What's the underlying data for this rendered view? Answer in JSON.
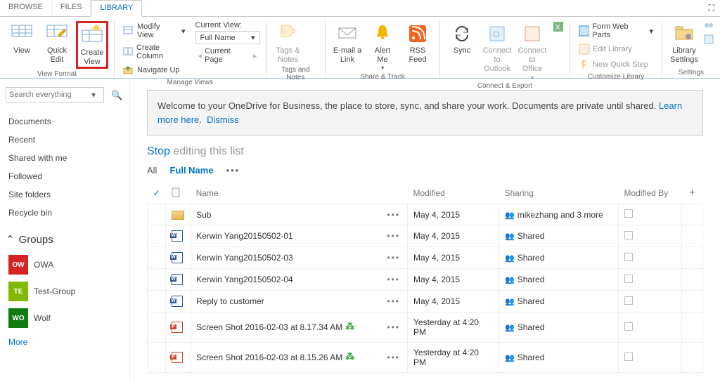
{
  "tabs": {
    "browse": "BROWSE",
    "files": "FILES",
    "library": "LIBRARY"
  },
  "ribbon": {
    "view_format": {
      "view": "View",
      "quick_edit": "Quick\nEdit",
      "create_view": "Create\nView",
      "label": "View Format"
    },
    "manage_views": {
      "modify_view": "Modify View",
      "create_column": "Create Column",
      "navigate_up": "Navigate Up",
      "current_view": "Current View:",
      "full_name": "Full Name",
      "current_page": "Current Page",
      "label": "Manage Views"
    },
    "tags_notes": {
      "tags": "Tags &\nNotes",
      "label": "Tags and Notes"
    },
    "share_track": {
      "email": "E-mail a\nLink",
      "alert": "Alert\nMe",
      "rss": "RSS\nFeed",
      "label": "Share & Track"
    },
    "connect_export": {
      "sync": "Sync",
      "outlook": "Connect to\nOutlook",
      "office": "Connect to\nOffice",
      "label": "Connect & Export"
    },
    "customize": {
      "form": "Form Web Parts",
      "edit": "Edit Library",
      "quick": "New Quick Step",
      "label": "Customize Library"
    },
    "settings": {
      "lib": "Library\nSettings",
      "label": "Settings"
    }
  },
  "sidebar": {
    "search_placeholder": "Search everything",
    "nav": [
      "Documents",
      "Recent",
      "Shared with me",
      "Followed",
      "Site folders",
      "Recycle bin"
    ],
    "groups_label": "Groups",
    "groups": [
      {
        "code": "OW",
        "color": "#d62424",
        "name": "OWA"
      },
      {
        "code": "TE",
        "color": "#7fba00",
        "name": "Test-Group"
      },
      {
        "code": "WO",
        "color": "#107c10",
        "name": "Wolf"
      }
    ],
    "more": "More"
  },
  "banner": {
    "text": "Welcome to your OneDrive for Business, the place to store, sync, and share your work. Documents are private until shared. ",
    "learn": "Learn more here",
    "dismiss": "Dismiss"
  },
  "list_header": {
    "stop": "Stop",
    "rest": " editing this list"
  },
  "views": {
    "all": "All",
    "full": "Full Name"
  },
  "columns": {
    "name": "Name",
    "modified": "Modified",
    "sharing": "Sharing",
    "modified_by": "Modified By"
  },
  "rows": [
    {
      "type": "folder",
      "name": "Sub",
      "new": false,
      "modified": "May 4, 2015",
      "sharing": "mikezhang and 3 more"
    },
    {
      "type": "doc",
      "name": "Kerwin Yang20150502-01",
      "new": false,
      "modified": "May 4, 2015",
      "sharing": "Shared"
    },
    {
      "type": "doc",
      "name": "Kerwin Yang20150502-03",
      "new": false,
      "modified": "May 4, 2015",
      "sharing": "Shared"
    },
    {
      "type": "doc",
      "name": "Kerwin Yang20150502-04",
      "new": false,
      "modified": "May 4, 2015",
      "sharing": "Shared"
    },
    {
      "type": "doc",
      "name": "Reply to customer",
      "new": false,
      "modified": "May 4, 2015",
      "sharing": "Shared"
    },
    {
      "type": "ppt",
      "name": "Screen Shot 2016-02-03 at 8.17.34 AM",
      "new": true,
      "modified": "Yesterday at 4:20 PM",
      "sharing": "Shared"
    },
    {
      "type": "ppt",
      "name": "Screen Shot 2016-02-03 at 8.15.26 AM",
      "new": true,
      "modified": "Yesterday at 4:20 PM",
      "sharing": "Shared"
    }
  ]
}
